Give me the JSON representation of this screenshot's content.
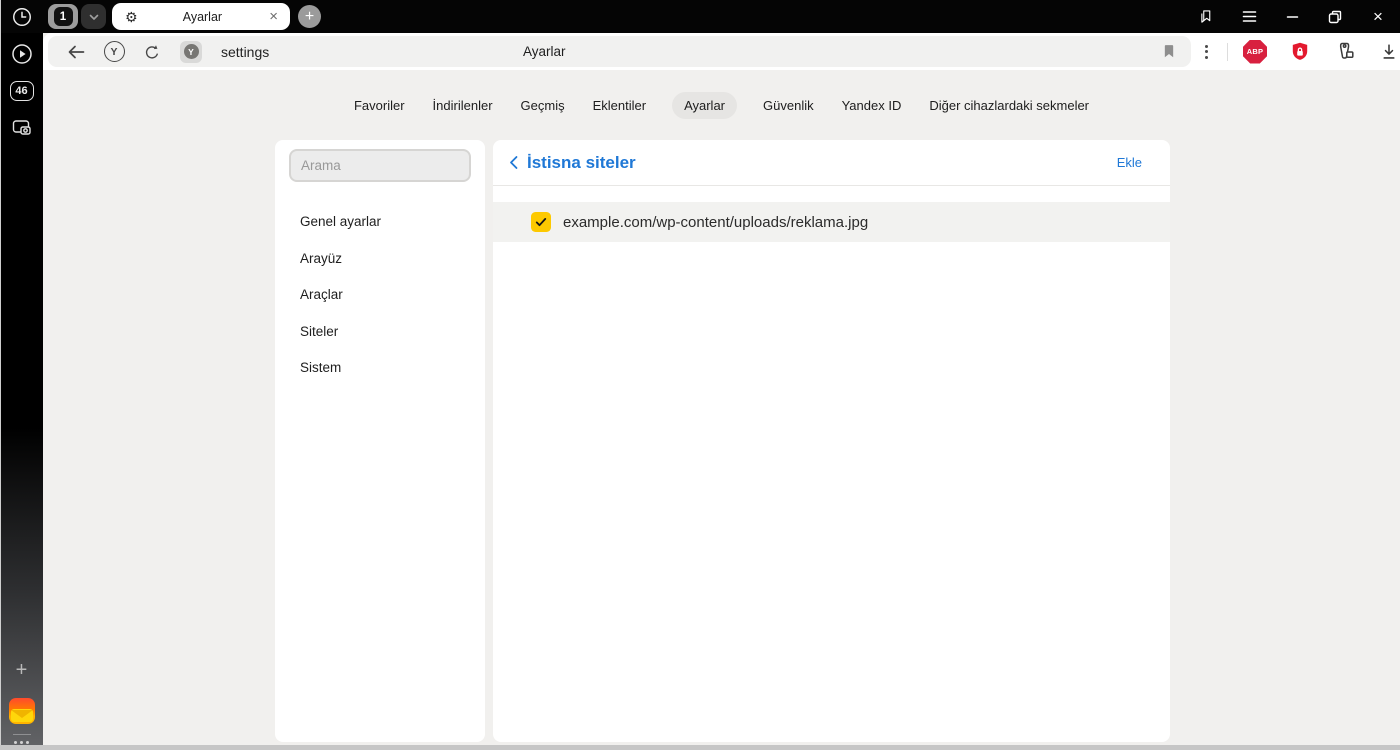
{
  "titlebar": {
    "tab_group_count": "1",
    "active_tab_title": "Ayarlar",
    "gear_icon": "⚙",
    "close_icon": "×",
    "new_tab_icon": "+"
  },
  "sidebar": {
    "tab_count_badge": "46",
    "plus_icon": "+"
  },
  "toolbar": {
    "url_text": "settings",
    "page_title": "Ayarlar",
    "yandex_letter": "Y",
    "favicon_letter": "Y"
  },
  "extensions": {
    "adblock_label": "ABP"
  },
  "settings_tabs": {
    "items": [
      "Favoriler",
      "İndirilenler",
      "Geçmiş",
      "Eklentiler",
      "Ayarlar",
      "Güvenlik",
      "Yandex ID",
      "Diğer cihazlardaki sekmeler"
    ],
    "active": "Ayarlar"
  },
  "settings_sidebar": {
    "search_placeholder": "Arama",
    "items": [
      "Genel ayarlar",
      "Arayüz",
      "Araçlar",
      "Siteler",
      "Sistem"
    ]
  },
  "exceptions_panel": {
    "title": "İstisna siteler",
    "add_button": "Ekle",
    "entries": [
      {
        "url": "example.com/wp-content/uploads/reklama.jpg",
        "checked": true
      }
    ]
  },
  "colors": {
    "accent_blue": "#1f78d6",
    "checkbox_yellow": "#fdc900",
    "abp_red": "#d8203f",
    "shield_red": "#e3192e",
    "page_background": "#f1f0ee"
  }
}
